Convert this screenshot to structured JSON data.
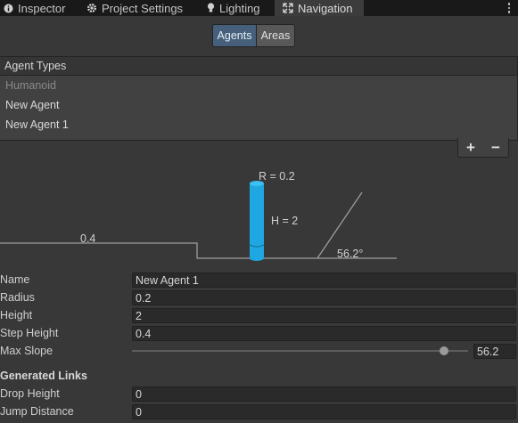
{
  "tabs": [
    {
      "label": "Inspector",
      "icon": "info-icon"
    },
    {
      "label": "Project Settings",
      "icon": "gear-icon"
    },
    {
      "label": "Lighting",
      "icon": "bulb-icon"
    },
    {
      "label": "Navigation",
      "icon": "navigation-icon",
      "active": true
    }
  ],
  "mode_toggle": {
    "agents": "Agents",
    "areas": "Areas",
    "selected": "Agents"
  },
  "agent_types": {
    "header": "Agent Types",
    "items": [
      "Humanoid",
      "New Agent",
      "New Agent 1"
    ],
    "add_label": "+",
    "remove_label": "−"
  },
  "diagram": {
    "radius_label": "R = 0.2",
    "height_label": "H = 2",
    "step_label": "0.4",
    "slope_label": "56.2°",
    "agent_color": "#1ea7e1"
  },
  "fields": {
    "name": {
      "label": "Name",
      "value": "New Agent 1"
    },
    "radius": {
      "label": "Radius",
      "value": "0.2"
    },
    "height": {
      "label": "Height",
      "value": "2"
    },
    "step_height": {
      "label": "Step Height",
      "value": "0.4"
    },
    "max_slope": {
      "label": "Max Slope",
      "value": "56.2",
      "fraction": 0.927
    }
  },
  "generated_links": {
    "title": "Generated Links",
    "drop_height": {
      "label": "Drop Height",
      "value": "0"
    },
    "jump_distance": {
      "label": "Jump Distance",
      "value": "0"
    }
  }
}
